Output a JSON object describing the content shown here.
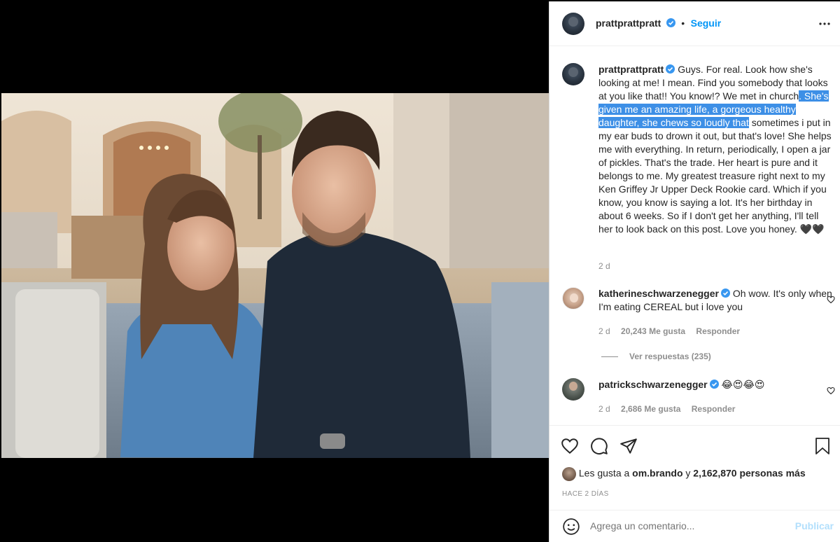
{
  "post": {
    "author": "prattprattpratt",
    "follow_label": "Seguir",
    "separator": "•",
    "caption_before": " Guys. For real. Look how she's looking at me! I mean. Find you somebody that looks at you like that!! You know!? We met in church",
    "caption_highlight": ". She's given me an amazing life, a gorgeous healthy daughter, she chews so loudly that",
    "caption_after": " sometimes i put in my ear buds to drown it out, but that's love! She helps me with everything. In return, periodically, I open a jar of pickles. That's the trade. Her heart is pure and it belongs to me. My greatest treasure right next to my Ken Griffey Jr Upper Deck Rookie card. Which if you know, you know is saying a lot. It's her birthday in about 6 weeks. So if I don't get her anything, I'll tell her to look back on this post. Love you honey. 🖤🖤",
    "caption_time": "2 d"
  },
  "comments": [
    {
      "user": "katherineschwarzenegger",
      "text": " Oh wow. It's only when I'm eating CEREAL but i love you",
      "time": "2 d",
      "likes": "20,243 Me gusta",
      "reply": "Responder",
      "view_replies": "Ver respuestas (235)"
    },
    {
      "user": "patrickschwarzenegger",
      "text": " 😂😍😂😍",
      "time": "2 d",
      "likes": "2,686 Me gusta",
      "reply": "Responder"
    }
  ],
  "likes": {
    "prefix": "Les gusta a ",
    "user": "om.brando",
    "middle": " y ",
    "count": "2,162,870 personas más"
  },
  "timestamp": "HACE 2 DÍAS",
  "composer": {
    "placeholder": "Agrega un comentario...",
    "publish": "Publicar"
  },
  "icons": {
    "more": "more-options-icon",
    "like": "heart-icon",
    "comment": "comment-icon",
    "share": "share-icon",
    "save": "bookmark-icon",
    "emoji": "emoji-icon"
  },
  "colors": {
    "accent": "#0095f6",
    "highlight": "#3d8fe6",
    "muted": "#8e8e8e"
  }
}
